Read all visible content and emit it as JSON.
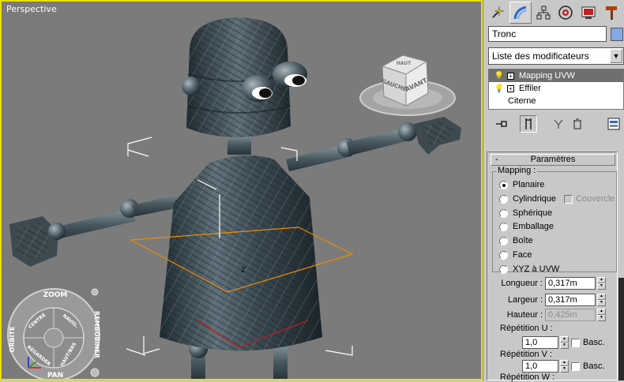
{
  "viewport": {
    "label": "Perspective",
    "viewcube": {
      "top_face": "HAUT",
      "left_face": "GAUCHE",
      "right_face": "AVANT"
    },
    "navwheel": {
      "top": "ZOOM",
      "left": "ORBITE",
      "right": "REMBOBINER",
      "bottom": "PAN",
      "inner_top_left": "CENTRE",
      "inner_top_right": "NAVIG.",
      "inner_bottom_left": "REGARDER",
      "inner_bottom_right": "HAUT/BAS"
    },
    "gizmo_label": "Z",
    "colors": {
      "border": "#e8e000",
      "background": "#7b7b7b",
      "gizmo": "#f08c00"
    }
  },
  "panel": {
    "tabs": [
      "create-icon",
      "modify-icon",
      "hierarchy-icon",
      "motion-icon",
      "display-icon",
      "utilities-icon"
    ],
    "object_name": "Tronc",
    "object_color": "#82a9e6",
    "modifier_list": "Liste des modificateurs",
    "stack": [
      {
        "label": "Mapping UVW",
        "selected": true
      },
      {
        "label": "Effiler",
        "selected": false
      },
      {
        "label": "Citerne",
        "selected": false
      }
    ],
    "rollout": {
      "title": "Paramètres",
      "collapse_symbol": "-",
      "mapping_group": "Mapping :",
      "options": [
        {
          "label": "Planaire",
          "checked": true
        },
        {
          "label": "Cylindrique",
          "checked": false
        },
        {
          "label": "Sphérique",
          "checked": false
        },
        {
          "label": "Emballage",
          "checked": false
        },
        {
          "label": "Boîte",
          "checked": false
        },
        {
          "label": "Face",
          "checked": false
        },
        {
          "label": "XYZ à UVW",
          "checked": false
        }
      ],
      "cap_label": "Couvercle",
      "length": {
        "label": "Longueur :",
        "value": "0,317m"
      },
      "width": {
        "label": "Largeur :",
        "value": "0,317m"
      },
      "height": {
        "label": "Hauteur :",
        "value": "0,425m"
      },
      "tile_u": {
        "label": "Répétition U :",
        "value": "1,0",
        "flip": "Basc."
      },
      "tile_v": {
        "label": "Répétition V :",
        "value": "1,0",
        "flip": "Basc."
      },
      "tile_w": {
        "label": "Répétition W :"
      }
    }
  }
}
